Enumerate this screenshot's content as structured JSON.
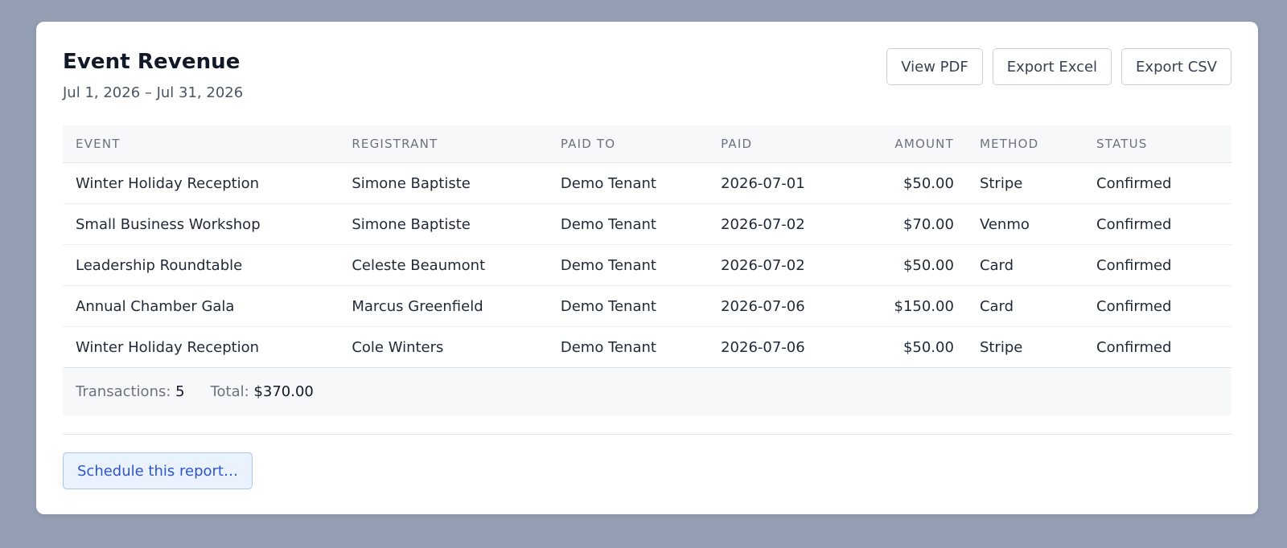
{
  "report": {
    "title": "Event Revenue",
    "date_range": "Jul 1, 2026 – Jul 31, 2026"
  },
  "actions": {
    "view_pdf": "View PDF",
    "export_excel": "Export Excel",
    "export_csv": "Export CSV"
  },
  "table": {
    "headers": {
      "event": "Event",
      "registrant": "Registrant",
      "paid_to": "Paid To",
      "paid": "Paid",
      "amount": "Amount",
      "method": "Method",
      "status": "Status"
    },
    "rows": [
      {
        "event": "Winter Holiday Reception",
        "registrant": "Simone Baptiste",
        "paid_to": "Demo Tenant",
        "paid": "2026-07-01",
        "amount": "$50.00",
        "method": "Stripe",
        "status": "Confirmed"
      },
      {
        "event": "Small Business Workshop",
        "registrant": "Simone Baptiste",
        "paid_to": "Demo Tenant",
        "paid": "2026-07-02",
        "amount": "$70.00",
        "method": "Venmo",
        "status": "Confirmed"
      },
      {
        "event": "Leadership Roundtable",
        "registrant": "Celeste Beaumont",
        "paid_to": "Demo Tenant",
        "paid": "2026-07-02",
        "amount": "$50.00",
        "method": "Card",
        "status": "Confirmed"
      },
      {
        "event": "Annual Chamber Gala",
        "registrant": "Marcus Greenfield",
        "paid_to": "Demo Tenant",
        "paid": "2026-07-06",
        "amount": "$150.00",
        "method": "Card",
        "status": "Confirmed"
      },
      {
        "event": "Winter Holiday Reception",
        "registrant": "Cole Winters",
        "paid_to": "Demo Tenant",
        "paid": "2026-07-06",
        "amount": "$50.00",
        "method": "Stripe",
        "status": "Confirmed"
      }
    ]
  },
  "summary": {
    "transactions_label": "Transactions:",
    "transactions_value": "5",
    "total_label": "Total:",
    "total_value": "$370.00"
  },
  "schedule": {
    "label": "Schedule this report…"
  },
  "colors": {
    "page_background": "#949fb3",
    "accent_blue": "#2e55c9",
    "accent_blue_bg": "#eaf2fe"
  }
}
